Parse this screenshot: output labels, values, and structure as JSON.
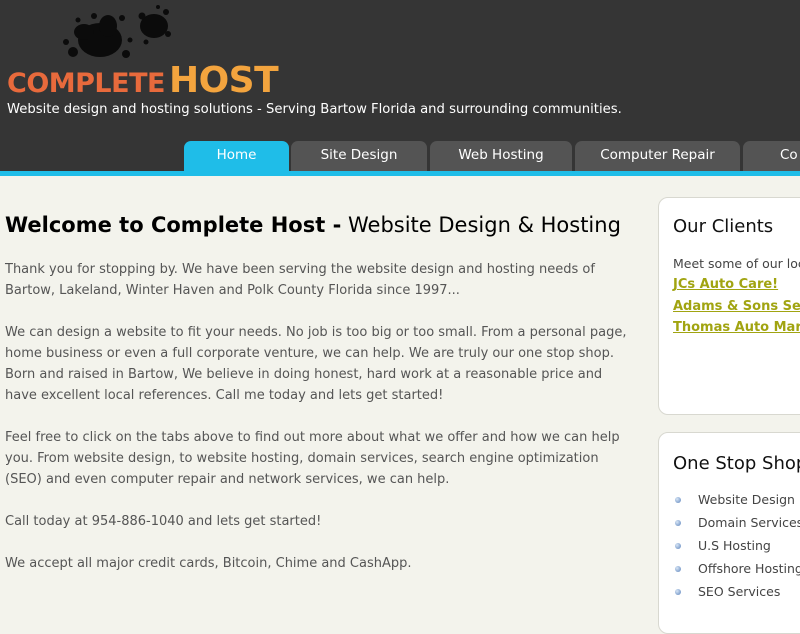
{
  "header": {
    "logo": {
      "word1": "COMPLETE",
      "word2": "HOST"
    },
    "tagline": "Website design and hosting solutions - Serving Bartow Florida and surrounding communities."
  },
  "nav": {
    "tabs": [
      {
        "label": "Home",
        "active": true
      },
      {
        "label": "Site Design",
        "active": false
      },
      {
        "label": "Web Hosting",
        "active": false
      },
      {
        "label": "Computer Repair",
        "active": false
      },
      {
        "label": "Co",
        "active": false
      }
    ]
  },
  "main": {
    "title_bold": "Welcome to Complete Host -",
    "title_rest": "Website Design & Hosting",
    "paragraphs": [
      "Thank you for stopping by. We have been serving the website design and hosting needs of Bartow, Lakeland, Winter Haven and Polk County Florida since 1997...",
      "We can design a website to fit your needs. No job is too big or too small. From a personal page, home business or even a full corporate venture, we can help. We are truly our one stop shop. Born and raised in Bartow, We believe in doing honest, hard work at a reasonable price and have excellent local references. Call me today and lets get started!",
      "Feel free to click on the tabs above to find out more about what we offer and how we can help you. From website design, to website hosting, domain services, search engine optimization (SEO) and even computer repair and network services, we can help.",
      "Call today at 954-886-1040 and lets get started!",
      "We accept all major credit cards, Bitcoin, Chime and CashApp."
    ]
  },
  "sidebar": {
    "clients": {
      "title": "Our Clients",
      "intro": "Meet some of our local",
      "links": [
        "JCs Auto Care!",
        "Adams & Sons Servic",
        "Thomas Auto Mart"
      ]
    },
    "shop": {
      "title": "One Stop Shop",
      "items": [
        "Website Design",
        "Domain Services",
        "U.S Hosting",
        "Offshore Hosting",
        "SEO Services"
      ]
    }
  },
  "colors": {
    "header_bg": "#353535",
    "accent": "#1fbde8",
    "tab_bg": "#545454",
    "page_bg": "#f3f3ec",
    "link": "#a1a411",
    "logo_orange": "#e86a3c",
    "logo_gold": "#f3a43e"
  }
}
